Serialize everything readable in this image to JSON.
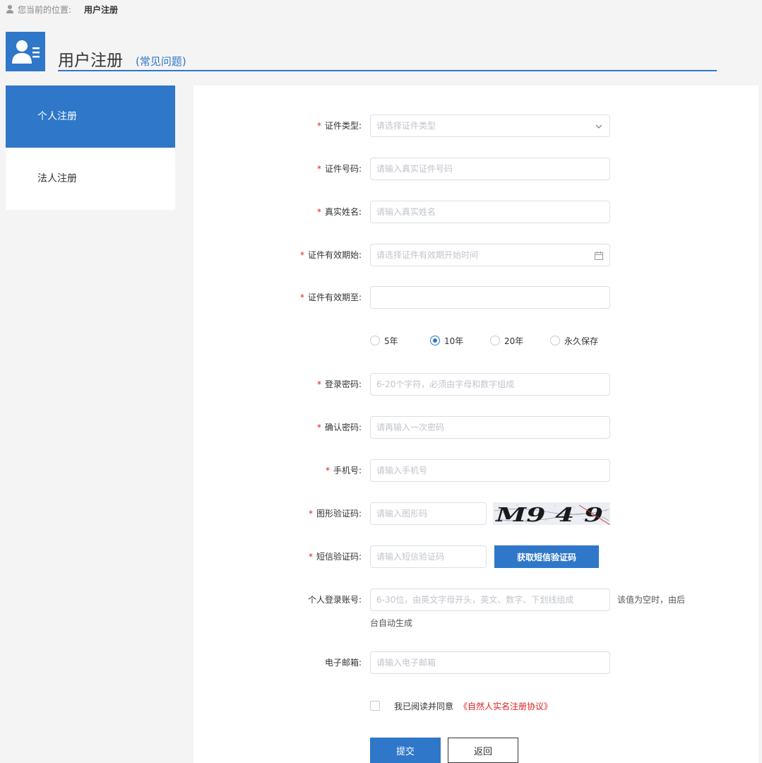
{
  "breadcrumb": {
    "prefix": "您当前的位置:",
    "current": "用户注册"
  },
  "header": {
    "title": "用户注册",
    "faq": "(常见问题)"
  },
  "sidebar": {
    "items": [
      {
        "label": "个人注册",
        "active": true
      },
      {
        "label": "法人注册",
        "active": false
      }
    ]
  },
  "form": {
    "id_type": {
      "label": "证件类型:",
      "placeholder": "请选择证件类型"
    },
    "id_number": {
      "label": "证件号码:",
      "placeholder": "请输入真实证件号码"
    },
    "real_name": {
      "label": "真实姓名:",
      "placeholder": "请输入真实姓名"
    },
    "valid_start": {
      "label": "证件有效期始:",
      "placeholder": "请选择证件有效期开始时间"
    },
    "valid_end": {
      "label": "证件有效期至:",
      "placeholder": ""
    },
    "validity_options": [
      {
        "label": "5年",
        "checked": false
      },
      {
        "label": "10年",
        "checked": true
      },
      {
        "label": "20年",
        "checked": false
      },
      {
        "label": "永久保存",
        "checked": false
      }
    ],
    "password": {
      "label": "登录密码:",
      "placeholder": "6-20个字符，必须由字母和数字组成"
    },
    "confirm_password": {
      "label": "确认密码:",
      "placeholder": "请再输入一次密码"
    },
    "phone": {
      "label": "手机号:",
      "placeholder": "请输入手机号"
    },
    "image_captcha": {
      "label": "图形验证码:",
      "placeholder": "请输入图形码",
      "captcha_text": "M9 4 9"
    },
    "sms_code": {
      "label": "短信验证码:",
      "placeholder": "请输入短信验证码",
      "button": "获取短信验证码"
    },
    "account": {
      "label": "个人登录账号:",
      "placeholder": "6-30位，由英文字母开头，英文、数字、下划线组成",
      "hint_1": "该值为空时，由后",
      "hint_2": "台自动生成"
    },
    "email": {
      "label": "电子邮箱:",
      "placeholder": "请输入电子邮箱"
    },
    "agreement": {
      "text": "我已阅读并同意",
      "link": "《自然人实名注册协议》"
    },
    "submit": "提交",
    "back": "返回"
  },
  "colors": {
    "primary": "#2f77c9",
    "required": "#e02020",
    "background": "#f4f4f4"
  }
}
